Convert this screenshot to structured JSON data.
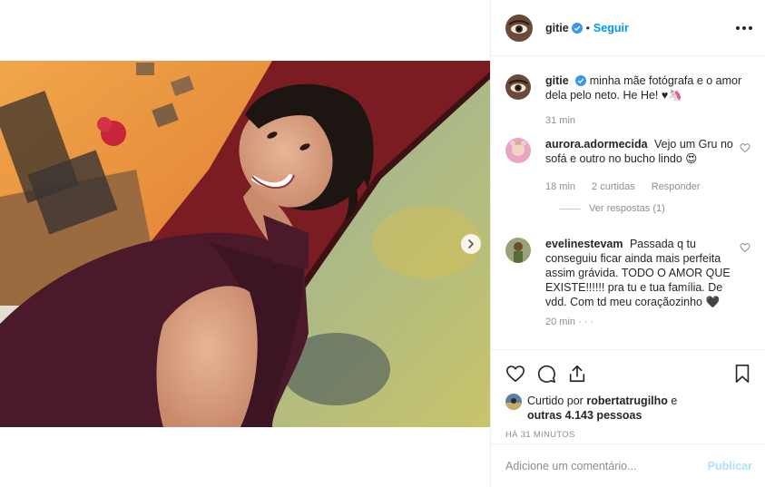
{
  "post": {
    "username": "gitie",
    "follow_label": "Seguir",
    "dot": "•",
    "caption": "minha mãe fotógrafa e o amor dela pelo neto. He He! ♥🦄",
    "caption_time": "31 min"
  },
  "comments": [
    {
      "username": "aurora.adormecida",
      "text": "Vejo um Gru no sofá e outro no bucho lindo 😍",
      "time": "18 min",
      "likes": "2 curtidas",
      "reply_label": "Responder",
      "view_replies": "Ver respostas (1)"
    },
    {
      "username": "evelinestevam",
      "text": "Passada q tu conseguiu ficar ainda mais perfeita assim grávida. TODO O AMOR QUE EXISTE!!!!!! pra tu e tua família. De vdd. Com td meu coraçãozinho 🖤",
      "partial_time": "20 min · · ·"
    }
  ],
  "likes": {
    "prefix": "Curtido por",
    "user": "robertatrugilho",
    "connector": "e",
    "others": "outras 4.143 pessoas"
  },
  "timestamp": "HÁ 31 MINUTOS",
  "composer": {
    "placeholder": "Adicione um comentário...",
    "post_label": "Publicar"
  },
  "colors": {
    "accent": "#0095f6",
    "post_disabled": "#b2dffc",
    "muted": "#8e8e8e"
  }
}
